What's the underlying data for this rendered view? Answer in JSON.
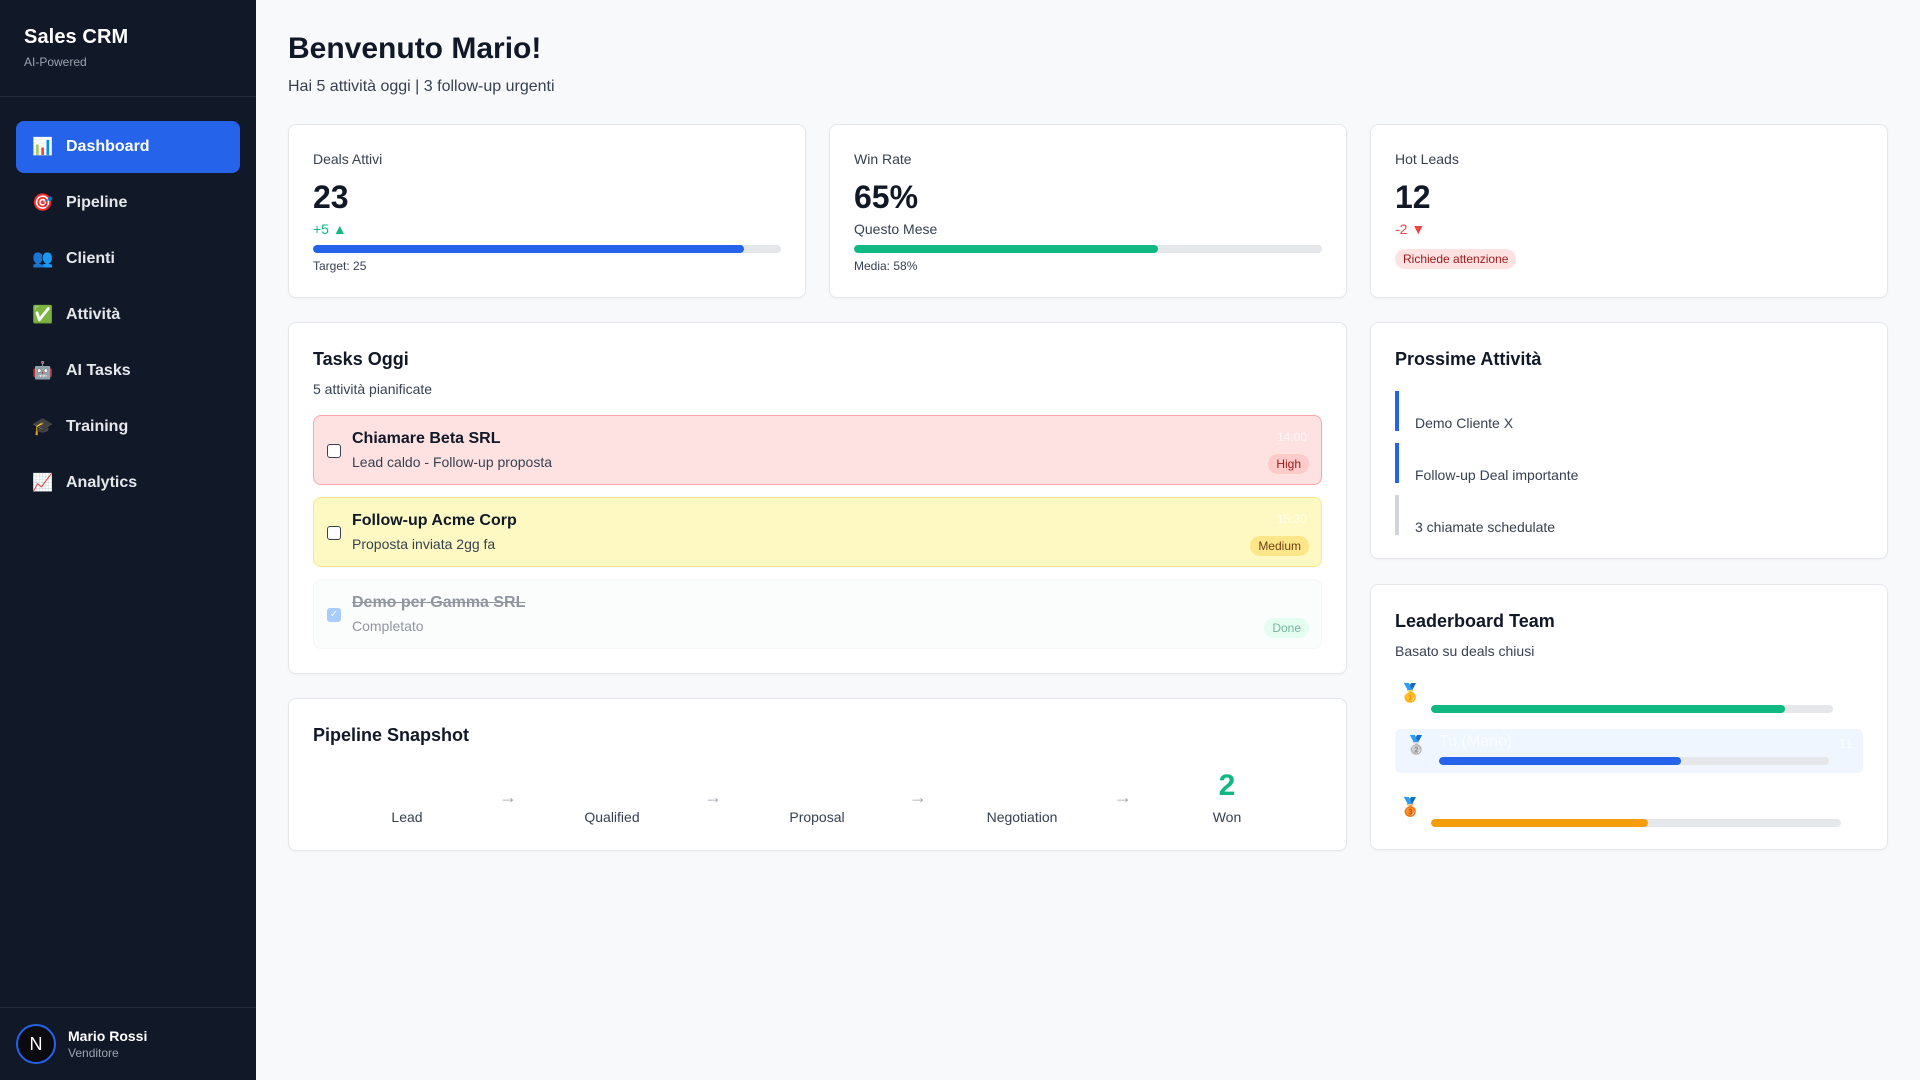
{
  "app": {
    "title": "Sales CRM",
    "subtitle": "AI-Powered"
  },
  "sidebar": {
    "items": [
      {
        "label": "Dashboard",
        "icon": "📊",
        "active": true
      },
      {
        "label": "Pipeline",
        "icon": "🎯"
      },
      {
        "label": "Clienti",
        "icon": "👥"
      },
      {
        "label": "Attività",
        "icon": "✅"
      },
      {
        "label": "AI Tasks",
        "icon": "🤖"
      },
      {
        "label": "Training",
        "icon": "🎓"
      },
      {
        "label": "Analytics",
        "icon": "📈"
      }
    ],
    "user": {
      "initial": "N",
      "name": "Mario Rossi",
      "role": "Venditore"
    }
  },
  "header": {
    "title": "Benvenuto Mario!",
    "subtitle": "Hai 5 attività oggi | 3 follow-up urgenti"
  },
  "stats": [
    {
      "label": "Deals Attivi",
      "value": "23",
      "delta": "+5 ▲",
      "progress": 0.92,
      "foot": "Target: 25",
      "color": "#2563eb"
    },
    {
      "label": "Win Rate",
      "value": "65%",
      "delta": "Questo Mese",
      "progress": 0.65,
      "foot": "Media: 58%",
      "color": "#10b981"
    },
    {
      "label": "Hot Leads",
      "value": "12",
      "delta": "-2 ▼",
      "badge": "Richiede attenzione"
    }
  ],
  "tasks": {
    "title": "Tasks Oggi",
    "subtitle": "5 attività pianificate",
    "items": [
      {
        "name": "Chiamare Beta SRL",
        "desc": "Lead caldo - Follow-up proposta",
        "time": "14:00",
        "badge": "High",
        "level": "high"
      },
      {
        "name": "Follow-up Acme Corp",
        "desc": "Proposta inviata 2gg fa",
        "time": "15:30",
        "badge": "Medium",
        "level": "medium"
      },
      {
        "name": "Demo per Gamma SRL",
        "desc": "Completato",
        "time": "",
        "badge": "Done",
        "level": "done"
      }
    ]
  },
  "pipeline": {
    "title": "Pipeline Snapshot",
    "stages": [
      {
        "label": "Lead",
        "count": ""
      },
      {
        "label": "Qualified",
        "count": ""
      },
      {
        "label": "Proposal",
        "count": ""
      },
      {
        "label": "Negotiation",
        "count": ""
      },
      {
        "label": "Won",
        "count": "2"
      }
    ],
    "arrow": "→"
  },
  "upcoming": {
    "title": "Prossime Attività",
    "items": [
      {
        "label": "Demo Cliente X",
        "color": "#2563eb"
      },
      {
        "label": "Follow-up Deal importante",
        "color": "#2563eb"
      },
      {
        "label": "3 chiamate schedulate",
        "color": "#d1d5db"
      }
    ]
  },
  "leaderboard": {
    "title": "Leaderboard Team",
    "subtitle": "Basato su deals chiusi",
    "rows": [
      {
        "medal": "🥇",
        "name": "",
        "score": "",
        "progress": 0.88,
        "color": "#10b981"
      },
      {
        "medal": "🥈",
        "name": "Tu (Mario)",
        "score": "11",
        "progress": 0.62,
        "color": "#2563eb",
        "me": true
      },
      {
        "medal": "🥉",
        "name": "",
        "score": "",
        "progress": 0.53,
        "color": "#f59e0b"
      }
    ]
  }
}
